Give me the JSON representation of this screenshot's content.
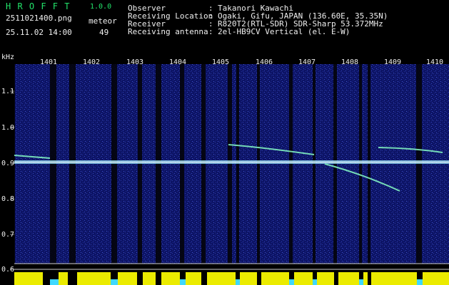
{
  "header": {
    "app_name": "H R O F F T",
    "version": "1.0.0",
    "file_name": "2511021400.png",
    "mode_label": "meteor",
    "timestamp": "25.11.02 14:00",
    "count": "49",
    "info_labels": [
      "Observer",
      "Receiving Location",
      "Receiver",
      "Receiving antenna"
    ],
    "info_values": [
      "Takanori Kawachi",
      "Ogaki, Gifu, JAPAN (136.60E, 35.35N)",
      "R820T2(RTL-SDR) SDR-Sharp 53.372MHz",
      "2el-HB9CV Vertical (el. E-W)"
    ]
  },
  "plot": {
    "y_unit": "kHz",
    "y_ticks": [
      "1.1",
      "1.0",
      "0.9",
      "0.8",
      "0.7",
      "0.6"
    ],
    "x_ticks": [
      "1401",
      "1402",
      "1403",
      "1404",
      "1405",
      "1406",
      "1407",
      "1408",
      "1409",
      "1410"
    ],
    "colors": {
      "background": "#000000",
      "noise": "#1a237e",
      "carrier": "#9fe8ff",
      "trace": "#7ff0c0",
      "bar": "#ffff00",
      "text_green": "#22e36a"
    }
  }
}
